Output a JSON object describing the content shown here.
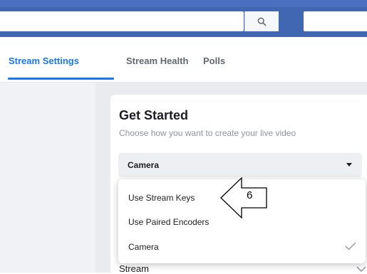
{
  "topbar": {
    "search_value": "",
    "search_icon": "search-icon"
  },
  "tabs": [
    {
      "label": "Stream Settings",
      "active": true
    },
    {
      "label": "Stream Health",
      "active": false
    },
    {
      "label": "Polls",
      "active": false
    }
  ],
  "card": {
    "title": "Get Started",
    "subtitle": "Choose how you want to create your live video",
    "select_value": "Camera",
    "partial_row_label": "Stream"
  },
  "menu": {
    "items": [
      {
        "label": "Use Stream Keys",
        "selected": false
      },
      {
        "label": "Use Paired Encoders",
        "selected": false
      },
      {
        "label": "Camera",
        "selected": true
      }
    ]
  },
  "callout": {
    "label": "6"
  },
  "colors": {
    "brand_blue": "#4267b2",
    "accent_blue": "#1877f2",
    "page_bg": "#e9ebee"
  }
}
